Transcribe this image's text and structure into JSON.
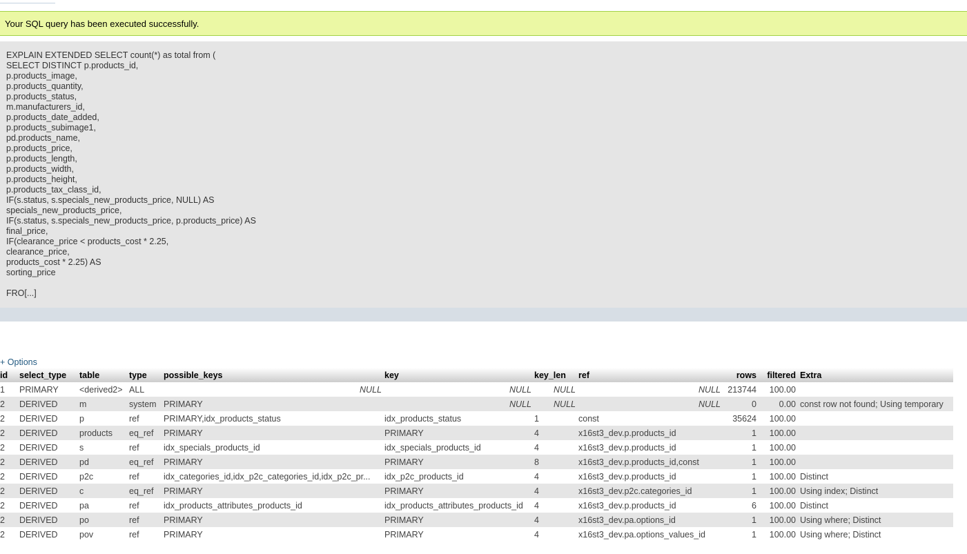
{
  "success_message": "Your SQL query has been executed successfully.",
  "sql_query": "EXPLAIN EXTENDED SELECT count(*) as total from (\nSELECT DISTINCT p.products_id,\np.products_image,\np.products_quantity,\np.products_status,\nm.manufacturers_id,\np.products_date_added,\np.products_subimage1,\npd.products_name,\np.products_price,\np.products_length,\np.products_width,\np.products_height,\np.products_tax_class_id,\nIF(s.status, s.specials_new_products_price, NULL) AS\nspecials_new_products_price,\nIF(s.status, s.specials_new_products_price, p.products_price) AS\nfinal_price,\nIF(clearance_price < products_cost * 2.25,\nclearance_price,\nproducts_cost * 2.25) AS\nsorting_price\n\nFRO[...]",
  "options_label": "+ Options",
  "columns": [
    "id",
    "select_type",
    "table",
    "type",
    "possible_keys",
    "key",
    "key_len",
    "ref",
    "rows",
    "filtered",
    "Extra"
  ],
  "rows": [
    {
      "id": "1",
      "select_type": "PRIMARY",
      "table": "<derived2>",
      "type": "ALL",
      "possible_keys": "NULL",
      "key": "NULL",
      "key_len": "NULL",
      "ref": "NULL",
      "rows": "213744",
      "filtered": "100.00",
      "extra": ""
    },
    {
      "id": "2",
      "select_type": "DERIVED",
      "table": "m",
      "type": "system",
      "possible_keys": "PRIMARY",
      "key": "NULL",
      "key_len": "NULL",
      "ref": "NULL",
      "rows": "0",
      "filtered": "0.00",
      "extra": "const row not found; Using temporary"
    },
    {
      "id": "2",
      "select_type": "DERIVED",
      "table": "p",
      "type": "ref",
      "possible_keys": "PRIMARY,idx_products_status",
      "key": "idx_products_status",
      "key_len": "1",
      "ref": "const",
      "rows": "35624",
      "filtered": "100.00",
      "extra": ""
    },
    {
      "id": "2",
      "select_type": "DERIVED",
      "table": "products",
      "type": "eq_ref",
      "possible_keys": "PRIMARY",
      "key": "PRIMARY",
      "key_len": "4",
      "ref": "x16st3_dev.p.products_id",
      "rows": "1",
      "filtered": "100.00",
      "extra": ""
    },
    {
      "id": "2",
      "select_type": "DERIVED",
      "table": "s",
      "type": "ref",
      "possible_keys": "idx_specials_products_id",
      "key": "idx_specials_products_id",
      "key_len": "4",
      "ref": "x16st3_dev.p.products_id",
      "rows": "1",
      "filtered": "100.00",
      "extra": ""
    },
    {
      "id": "2",
      "select_type": "DERIVED",
      "table": "pd",
      "type": "eq_ref",
      "possible_keys": "PRIMARY",
      "key": "PRIMARY",
      "key_len": "8",
      "ref": "x16st3_dev.p.products_id,const",
      "rows": "1",
      "filtered": "100.00",
      "extra": ""
    },
    {
      "id": "2",
      "select_type": "DERIVED",
      "table": "p2c",
      "type": "ref",
      "possible_keys": "idx_categories_id,idx_p2c_categories_id,idx_p2c_pr...",
      "key": "idx_p2c_products_id",
      "key_len": "4",
      "ref": "x16st3_dev.p.products_id",
      "rows": "1",
      "filtered": "100.00",
      "extra": "Distinct"
    },
    {
      "id": "2",
      "select_type": "DERIVED",
      "table": "c",
      "type": "eq_ref",
      "possible_keys": "PRIMARY",
      "key": "PRIMARY",
      "key_len": "4",
      "ref": "x16st3_dev.p2c.categories_id",
      "rows": "1",
      "filtered": "100.00",
      "extra": "Using index; Distinct"
    },
    {
      "id": "2",
      "select_type": "DERIVED",
      "table": "pa",
      "type": "ref",
      "possible_keys": "idx_products_attributes_products_id",
      "key": "idx_products_attributes_products_id",
      "key_len": "4",
      "ref": "x16st3_dev.p.products_id",
      "rows": "6",
      "filtered": "100.00",
      "extra": "Distinct"
    },
    {
      "id": "2",
      "select_type": "DERIVED",
      "table": "po",
      "type": "ref",
      "possible_keys": "PRIMARY",
      "key": "PRIMARY",
      "key_len": "4",
      "ref": "x16st3_dev.pa.options_id",
      "rows": "1",
      "filtered": "100.00",
      "extra": "Using where; Distinct"
    },
    {
      "id": "2",
      "select_type": "DERIVED",
      "table": "pov",
      "type": "ref",
      "possible_keys": "PRIMARY",
      "key": "PRIMARY",
      "key_len": "4",
      "ref": "x16st3_dev.pa.options_values_id",
      "rows": "1",
      "filtered": "100.00",
      "extra": "Using where; Distinct"
    }
  ],
  "colors": {
    "success_bg": "#ebf8a4",
    "success_border": "#a2d246",
    "sql_bg": "#e5e5e5",
    "link": "#235a81"
  }
}
